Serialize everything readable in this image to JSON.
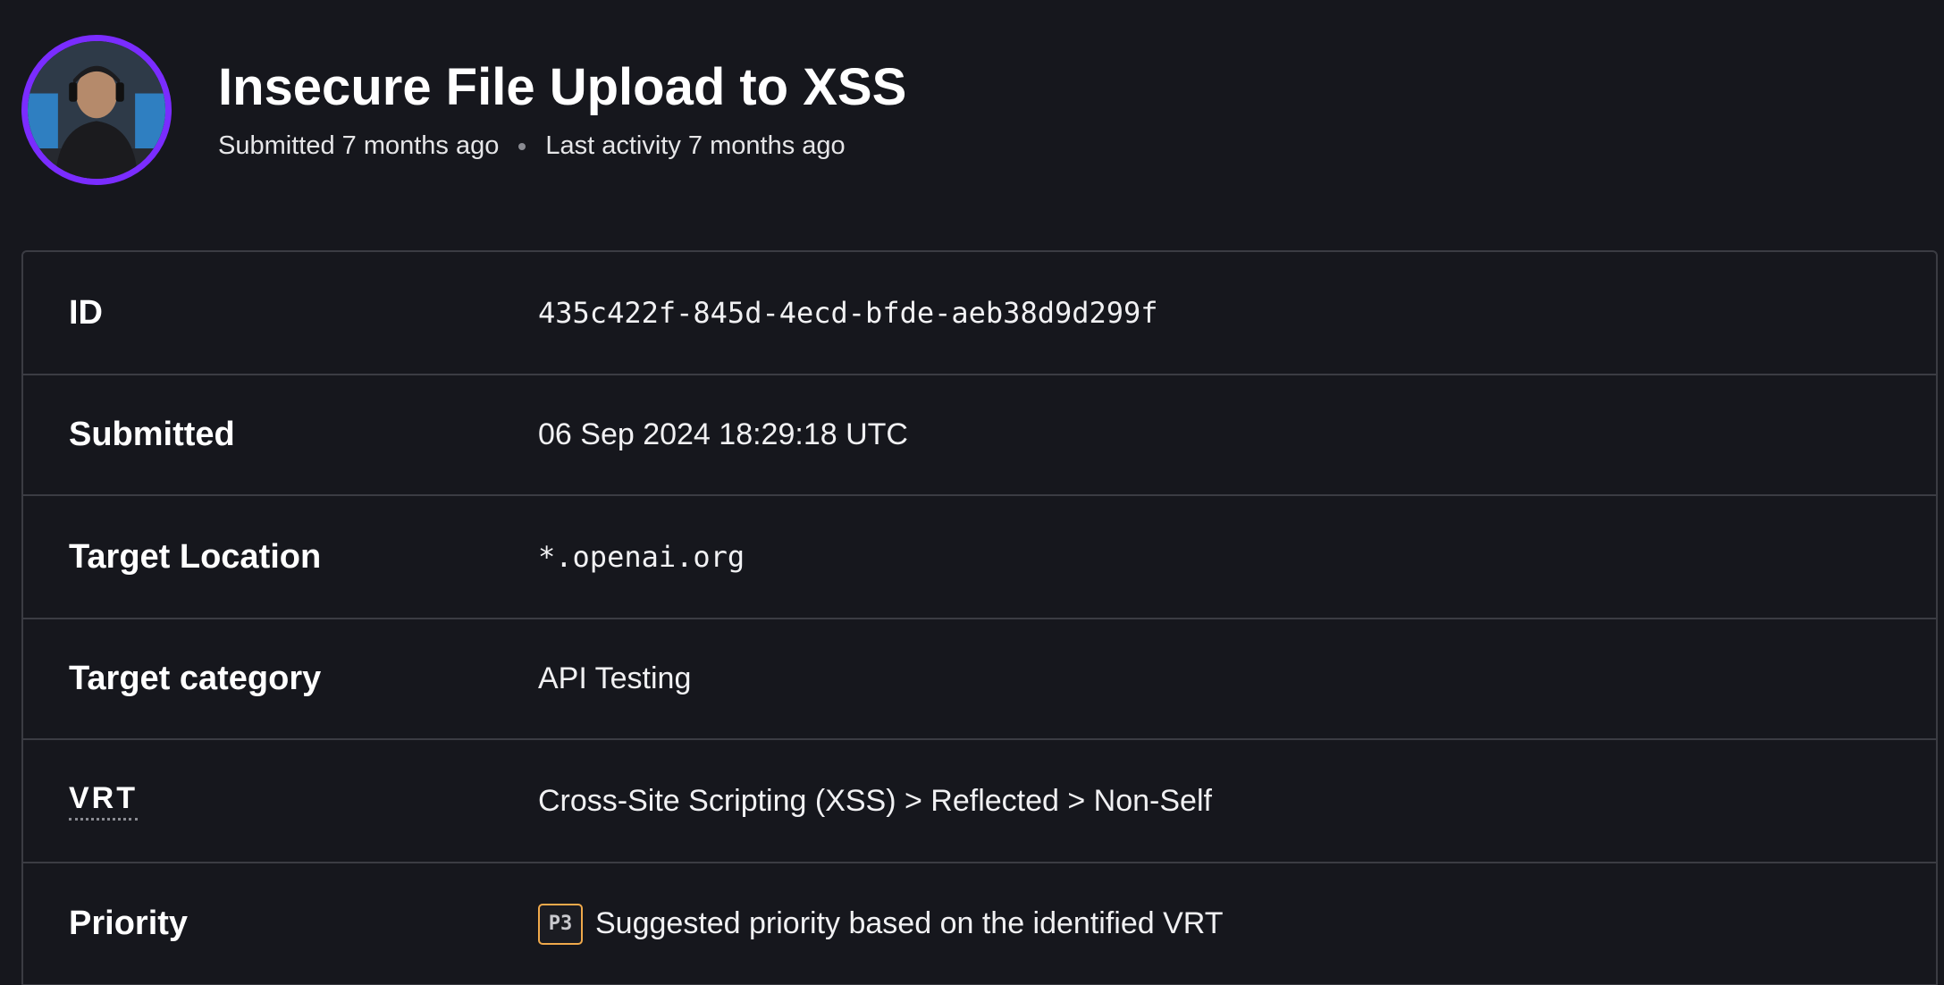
{
  "report": {
    "title": "Insecure File Upload to XSS",
    "submitted_relative": "Submitted 7 months ago",
    "last_activity": "Last activity 7 months ago"
  },
  "details": {
    "id": {
      "label": "ID",
      "value": "435c422f-845d-4ecd-bfde-aeb38d9d299f"
    },
    "submitted": {
      "label": "Submitted",
      "value": "06 Sep 2024 18:29:18 UTC"
    },
    "target_location": {
      "label": "Target Location",
      "value": "*.openai.org"
    },
    "target_category": {
      "label": "Target category",
      "value": "API Testing"
    },
    "vrt": {
      "label": "VRT",
      "value": "Cross-Site Scripting (XSS) > Reflected > Non-Self"
    },
    "priority": {
      "label": "Priority",
      "badge": "P3",
      "value": "Suggested priority based on the identified VRT"
    }
  },
  "colors": {
    "background": "#16171d",
    "avatar_ring": "#7a2cff",
    "border": "#3b3c43",
    "priority_badge_border": "#f0a94b"
  },
  "icons": {
    "avatar": "user-avatar-photo"
  }
}
